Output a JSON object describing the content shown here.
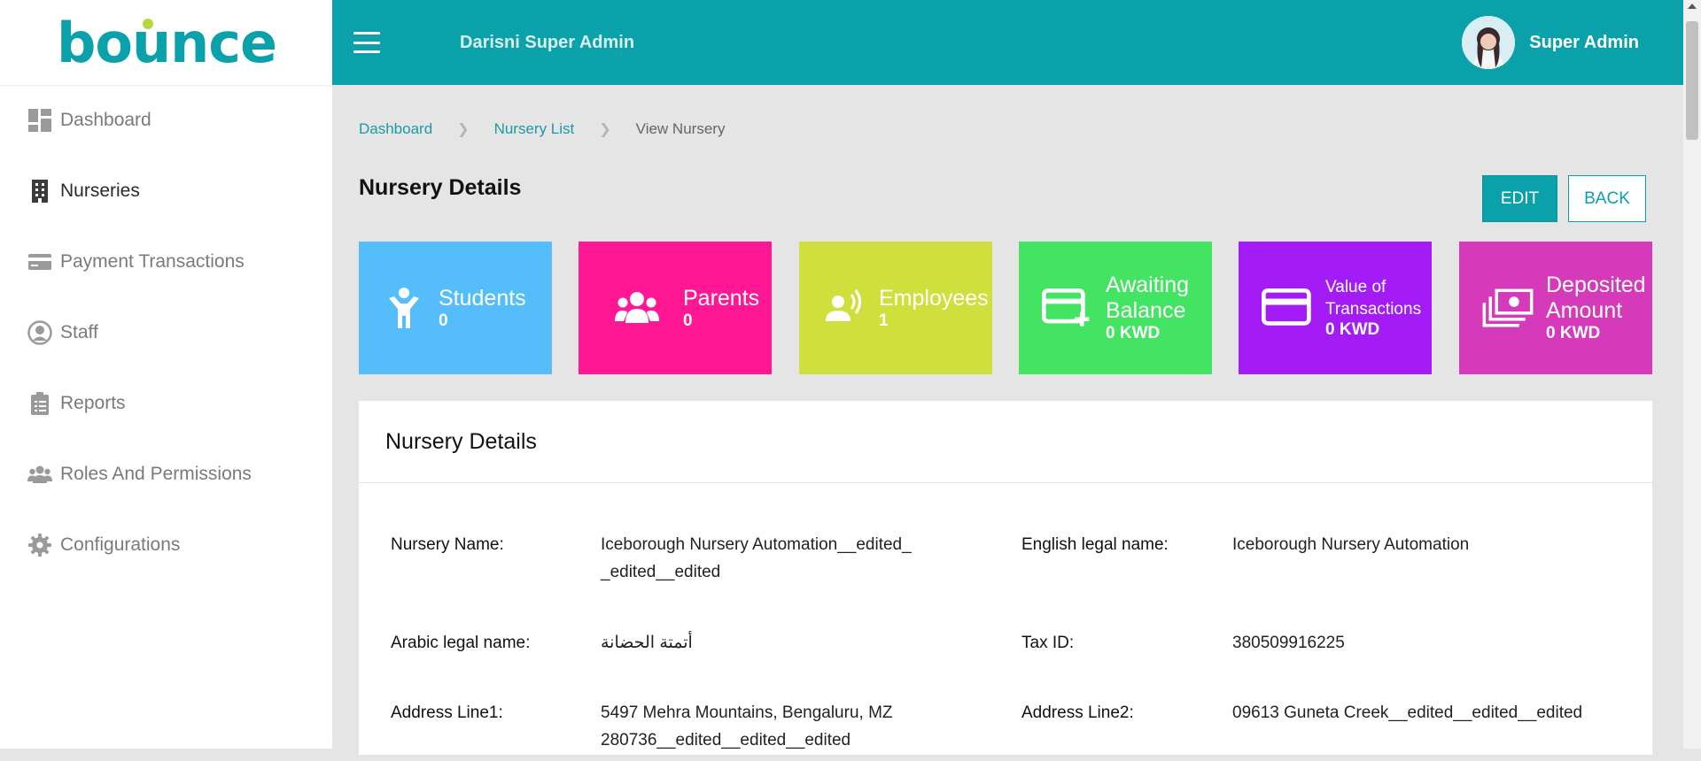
{
  "brand": {
    "logo_text": "bounce",
    "colors": {
      "primary": "#0aa1aa",
      "accent": "#b5d83a"
    }
  },
  "sidebar": {
    "items": [
      {
        "label": "Dashboard",
        "icon": "dashboard-icon",
        "active": false
      },
      {
        "label": "Nurseries",
        "icon": "building-icon",
        "active": true
      },
      {
        "label": "Payment Transactions",
        "icon": "credit-card-icon",
        "active": false
      },
      {
        "label": "Staff",
        "icon": "user-circle-icon",
        "active": false
      },
      {
        "label": "Reports",
        "icon": "clipboard-icon",
        "active": false
      },
      {
        "label": "Roles And Permissions",
        "icon": "users-icon",
        "active": false
      },
      {
        "label": "Configurations",
        "icon": "gear-icon",
        "active": false
      }
    ]
  },
  "header": {
    "title": "Darisni Super Admin",
    "user_name": "Super Admin",
    "menu_icon": "hamburger-icon"
  },
  "breadcrumb": {
    "items": [
      "Dashboard",
      "Nursery List"
    ],
    "current": "View Nursery"
  },
  "page": {
    "title": "Nursery Details",
    "edit_label": "EDIT",
    "back_label": "BACK"
  },
  "stats": [
    {
      "label": "Students",
      "value": "0",
      "color": "#55bdf9",
      "icon": "child-icon"
    },
    {
      "label": "Parents",
      "value": "0",
      "color": "#ff1793",
      "icon": "users-icon"
    },
    {
      "label": "Employees",
      "value": "1",
      "color": "#cfdf3b",
      "icon": "employee-voice-icon"
    },
    {
      "label": "Awaiting\nBalance",
      "value": "0 KWD",
      "color": "#42e461",
      "icon": "card-plus-icon"
    },
    {
      "label": "Value of\nTransactions",
      "value": "0 KWD",
      "color": "#a41cf5",
      "icon": "credit-card-icon"
    },
    {
      "label": "Deposited\nAmount",
      "value": "0 KWD",
      "color": "#d43aba",
      "icon": "money-icon"
    }
  ],
  "details": {
    "title": "Nursery Details",
    "fields": {
      "nursery_name": {
        "label": "Nursery Name:",
        "value": "Iceborough Nursery Automation__edited__edited__edited"
      },
      "english_legal_name": {
        "label": "English legal name:",
        "value": "Iceborough Nursery Automation"
      },
      "arabic_legal_name": {
        "label": "Arabic legal name:",
        "value": "أتمتة الحضانة"
      },
      "tax_id": {
        "label": "Tax ID:",
        "value": "380509916225"
      },
      "address_line1": {
        "label": "Address Line1:",
        "value": "5497 Mehra Mountains, Bengaluru, MZ 280736__edited__edited__edited"
      },
      "address_line2": {
        "label": "Address Line2:",
        "value": "09613 Guneta Creek__edited__edited__edited"
      }
    }
  }
}
